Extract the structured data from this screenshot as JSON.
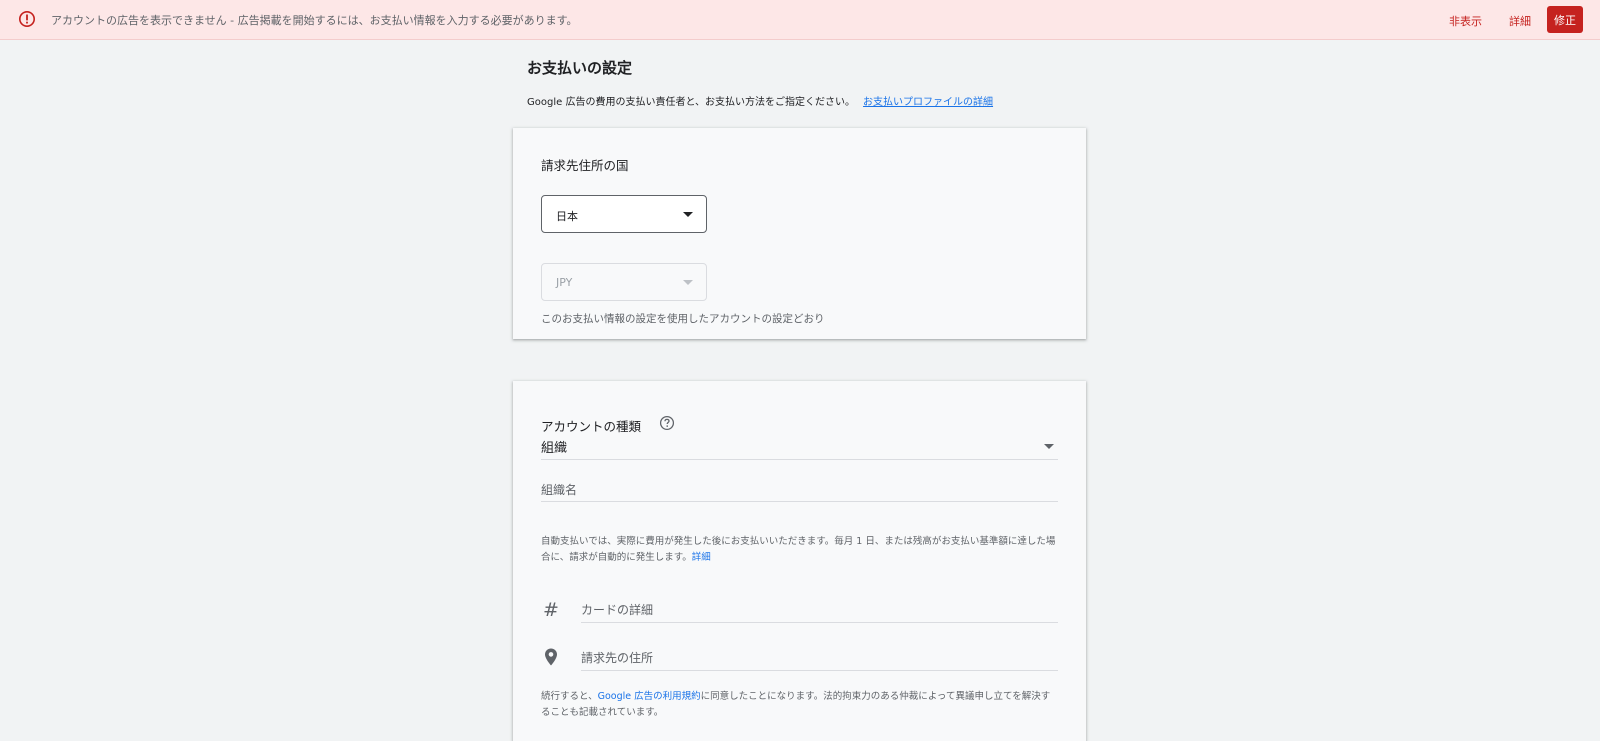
{
  "banner": {
    "message": "アカウントの広告を表示できません - 広告掲載を開始するには、お支払い情報を入力する必要があります。",
    "hide_label": "非表示",
    "details_label": "詳細",
    "fix_label": "修正"
  },
  "header": {
    "title": "お支払いの設定",
    "description": "Google 広告の費用の支払い責任者と、お支払い方法をご指定ください。",
    "profile_link": "お支払いプロファイルの詳細"
  },
  "country_card": {
    "label": "請求先住所の国",
    "country_value": "日本",
    "currency_value": "JPY",
    "currency_hint": "このお支払い情報の設定を使用したアカウントの設定どおり"
  },
  "account_card": {
    "type_label": "アカウントの種類",
    "type_value": "組織",
    "org_name_placeholder": "組織名",
    "autopay_text": "自動支払いでは、実際に費用が発生した後にお支払いいただきます。毎月 1 日、または残高がお支払い基準額に達した場合に、請求が自動的に発生します。",
    "autopay_link": "詳細",
    "card_details_placeholder": "カードの詳細",
    "billing_address_placeholder": "請求先の住所",
    "terms_prefix": "続行すると、",
    "terms_link": "Google 広告の利用規約",
    "terms_suffix": "に同意したことになります。法的拘束力のある仲裁によって異議申し立てを解決することも記載されています。",
    "hash_glyph": "#"
  },
  "icons": {
    "error": "error-icon",
    "help": "help-icon",
    "hash": "hash-icon",
    "location": "location-pin-icon"
  },
  "colors": {
    "error_red": "#c5221f",
    "banner_bg": "#fde7e7",
    "link_blue": "#1a73e8"
  }
}
